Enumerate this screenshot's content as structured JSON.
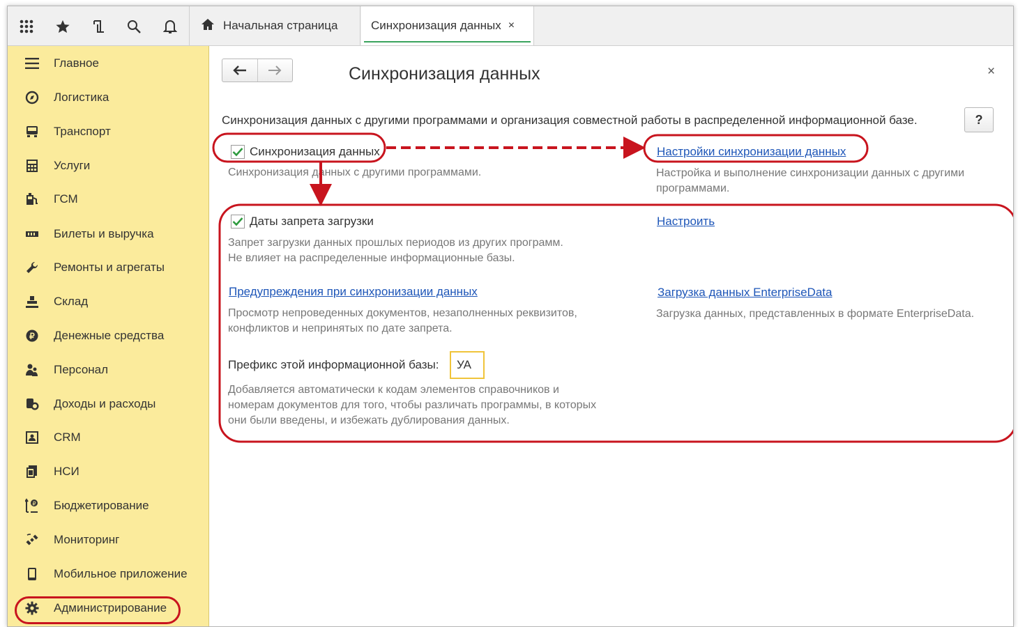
{
  "tabs": {
    "home_label": "Начальная страница",
    "active_label": "Синхронизация данных",
    "close_glyph": "×"
  },
  "toolbar_icons": [
    "apps-grid-icon",
    "star-icon",
    "history-icon",
    "search-icon",
    "bell-icon"
  ],
  "sidebar": {
    "items": [
      {
        "label": "Главное",
        "icon": "menu-icon"
      },
      {
        "label": "Логистика",
        "icon": "compass-icon"
      },
      {
        "label": "Транспорт",
        "icon": "truck-icon"
      },
      {
        "label": "Услуги",
        "icon": "calculator-icon"
      },
      {
        "label": "ГСМ",
        "icon": "fuel-icon"
      },
      {
        "label": "Билеты и выручка",
        "icon": "ticket-icon"
      },
      {
        "label": "Ремонты и агрегаты",
        "icon": "wrench-icon"
      },
      {
        "label": "Склад",
        "icon": "warehouse-icon"
      },
      {
        "label": "Денежные средства",
        "icon": "money-icon"
      },
      {
        "label": "Персонал",
        "icon": "people-icon"
      },
      {
        "label": "Доходы и расходы",
        "icon": "coins-icon"
      },
      {
        "label": "CRM",
        "icon": "crm-icon"
      },
      {
        "label": "НСИ",
        "icon": "reference-icon"
      },
      {
        "label": "Бюджетирование",
        "icon": "budget-icon"
      },
      {
        "label": "Мониторинг",
        "icon": "satellite-icon"
      },
      {
        "label": "Мобильное приложение",
        "icon": "phone-icon"
      },
      {
        "label": "Администрирование",
        "icon": "gear-icon"
      }
    ]
  },
  "page": {
    "title": "Синхронизация данных",
    "close_glyph": "×",
    "description": "Синхронизация данных с другими программами и организация совместной работы в распределенной информационной базе.",
    "help_label": "?"
  },
  "sync": {
    "checkbox_label": "Синхронизация данных",
    "checked": true,
    "hint": "Синхронизация данных с другими программами.",
    "settings_link": "Настройки синхронизации данных",
    "settings_hint_1": "Настройка и выполнение синхронизации данных с другими",
    "settings_hint_2": "программами."
  },
  "ban_dates": {
    "checkbox_label": "Даты запрета загрузки",
    "checked": true,
    "hint_1": "Запрет загрузки данных прошлых периодов из других программ.",
    "hint_2": "Не влияет на распределенные информационные базы.",
    "configure_link": "Настроить"
  },
  "warnings": {
    "link": "Предупреждения при синхронизации данных",
    "hint_1": "Просмотр непроведенных документов, незаполненных реквизитов,",
    "hint_2": "конфликтов и непринятых по дате запрета."
  },
  "enterprise": {
    "link": "Загрузка данных EnterpriseData",
    "hint": "Загрузка данных, представленных в формате EnterpriseData."
  },
  "prefix": {
    "label": "Префикс этой информационной базы:",
    "value": "УА",
    "hint_1": "Добавляется автоматически к кодам элементов справочников и",
    "hint_2": "номерам документов для того, чтобы различать программы, в которых",
    "hint_3": "они были введены, и избежать дублирования данных."
  },
  "colors": {
    "sidebar_bg": "#fbeb9c",
    "annotation_red": "#c8141e",
    "link_blue": "#1e56b8",
    "check_green": "#2e9a3e",
    "active_tab_underline": "#3aa35d",
    "prefix_border": "#f0c43a"
  }
}
